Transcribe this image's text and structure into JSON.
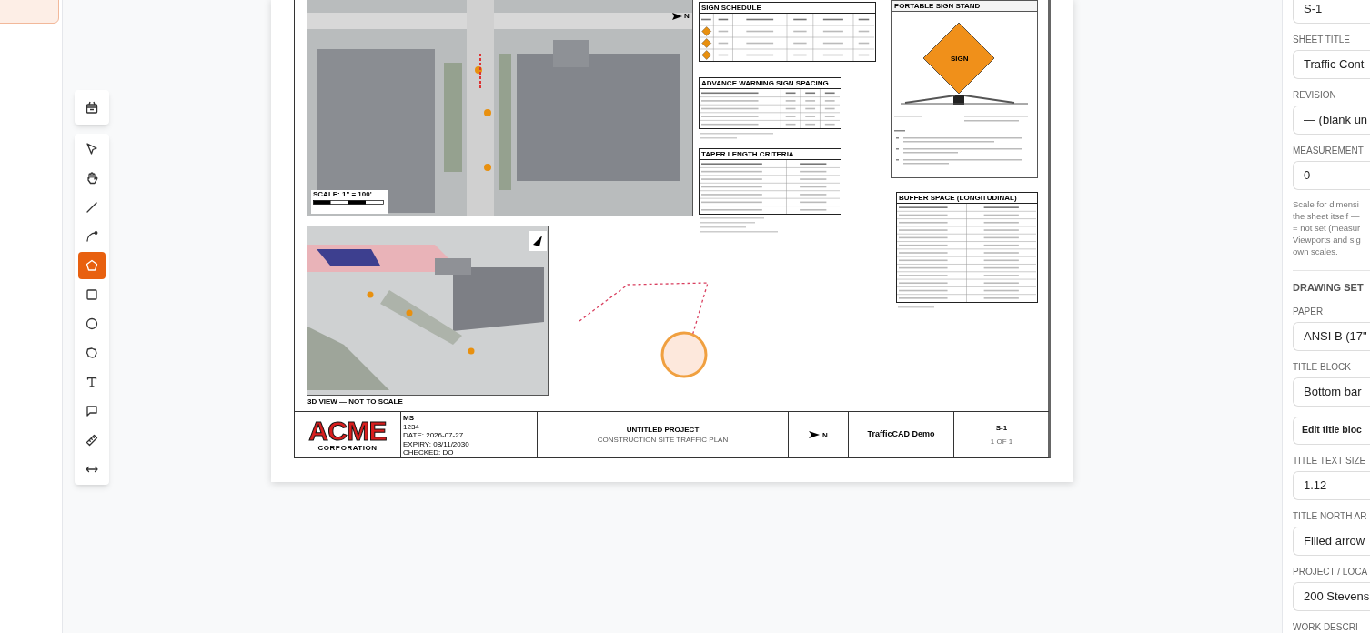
{
  "toolbar": {
    "tools": [
      {
        "kind": "select",
        "selected": false
      },
      {
        "kind": "pan",
        "selected": false
      },
      {
        "kind": "line",
        "selected": false
      },
      {
        "kind": "arc",
        "selected": false
      },
      {
        "kind": "polygon",
        "selected": true
      },
      {
        "kind": "rect",
        "selected": false
      },
      {
        "kind": "circle",
        "selected": false
      },
      {
        "kind": "cloud",
        "selected": false
      },
      {
        "kind": "text",
        "selected": false
      },
      {
        "kind": "callout",
        "selected": false
      },
      {
        "kind": "ruler",
        "selected": false
      },
      {
        "kind": "dimension",
        "selected": false
      }
    ]
  },
  "sheet": {
    "top_map": {
      "scale_label": "SCALE: 1\" = 100'",
      "north_letter": "N"
    },
    "view_3d": {
      "caption": "3D VIEW — NOT TO SCALE"
    },
    "sign_schedule": {
      "title": "SIGN SCHEDULE"
    },
    "advance_warning": {
      "title": "ADVANCE WARNING SIGN SPACING"
    },
    "taper": {
      "title": "TAPER LENGTH CRITERIA"
    },
    "sign_stand": {
      "title": "PORTABLE SIGN STAND",
      "sign_label": "SIGN"
    },
    "buffer": {
      "title": "BUFFER SPACE (LONGITUDINAL)"
    },
    "title_block": {
      "logo_main": "ACME",
      "logo_sub": "CORPORATION",
      "drawn_lines": [
        "MS",
        "1234",
        "DATE: 2026-07-27",
        "EXPIRY: 08/11/2030",
        "CHECKED: DO"
      ],
      "project": "UNTITLED PROJECT",
      "subtitle": "CONSTRUCTION SITE TRAFFIC PLAN",
      "north_letter": "N",
      "plan_by": "TrafficCAD Demo",
      "sheet": "S-1",
      "sheet_count": "1 OF 1"
    }
  },
  "properties": {
    "items": [
      {
        "kind": "field",
        "value": "S-1"
      },
      {
        "kind": "field",
        "label": "SHEET TITLE",
        "value": "Traffic Cont"
      },
      {
        "kind": "field",
        "label": "REVISION",
        "value": "— (blank un"
      },
      {
        "kind": "field",
        "label": "MEASUREMENT",
        "value": "0"
      },
      {
        "kind": "help",
        "lines": [
          "Scale for dimensi",
          "the sheet itself —",
          "= not set (measur",
          "Viewports and sig",
          "own scales."
        ]
      },
      {
        "kind": "section",
        "label": "DRAWING SET"
      },
      {
        "kind": "field",
        "label": "PAPER",
        "value": "ANSI B (17\""
      },
      {
        "kind": "field",
        "label": "TITLE BLOCK",
        "value": "Bottom bar"
      },
      {
        "kind": "button",
        "label": "Edit title bloc"
      },
      {
        "kind": "field",
        "label": "TITLE TEXT SIZE",
        "value": "1.12"
      },
      {
        "kind": "field",
        "label": "TITLE NORTH AR",
        "value": "Filled arrow"
      },
      {
        "kind": "field",
        "label": "PROJECT / LOCA",
        "value": "200 Stevens"
      },
      {
        "kind": "label",
        "label": "WORK DESCRI"
      }
    ]
  }
}
